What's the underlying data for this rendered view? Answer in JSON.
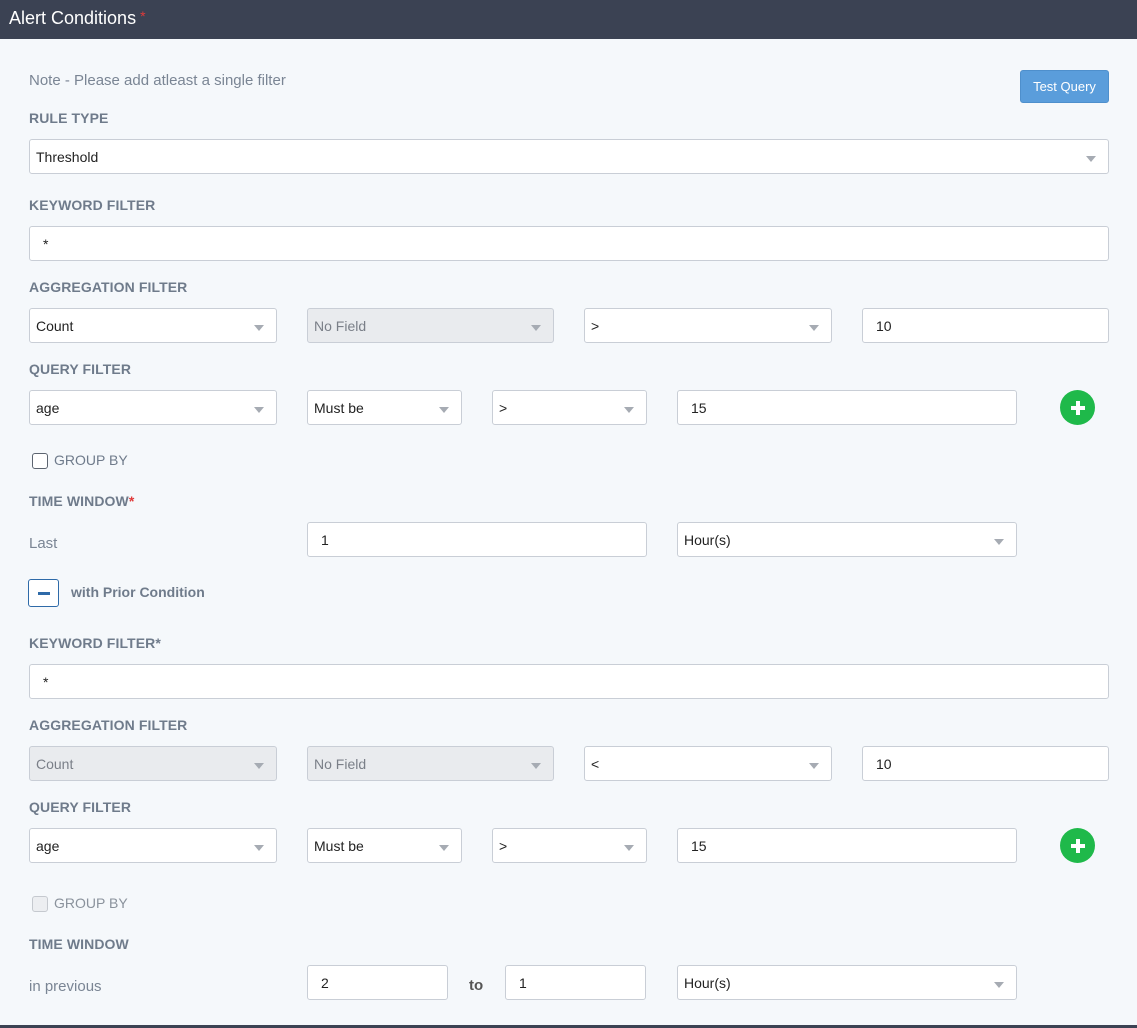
{
  "header": {
    "title": "Alert Conditions",
    "required_mark": "*"
  },
  "note": "Note - Please add atleast a single filter",
  "test_query_label": "Test Query",
  "rule_type": {
    "label": "RULE TYPE",
    "value": "Threshold"
  },
  "keyword_filter_1": {
    "label": "KEYWORD FILTER",
    "value": "*"
  },
  "aggregation_filter_1": {
    "label": "AGGREGATION FILTER",
    "function": "Count",
    "field": "No Field",
    "operator": ">",
    "value": "10"
  },
  "query_filter_1": {
    "label": "QUERY FILTER",
    "field": "age",
    "condition": "Must be",
    "operator": ">",
    "value": "15"
  },
  "group_by_1": {
    "label": "GROUP BY",
    "checked": false
  },
  "time_window_1": {
    "label": "TIME WINDOW",
    "required_mark": "*",
    "prefix": "Last",
    "value": "1",
    "unit": "Hour(s)"
  },
  "prior_condition_label": "with Prior Condition",
  "keyword_filter_2": {
    "label": "KEYWORD FILTER",
    "required_mark": "*",
    "value": "*"
  },
  "aggregation_filter_2": {
    "label": "AGGREGATION FILTER",
    "function": "Count",
    "field": "No Field",
    "operator": "<",
    "value": "10"
  },
  "query_filter_2": {
    "label": "QUERY FILTER",
    "field": "age",
    "condition": "Must be",
    "operator": ">",
    "value": "15"
  },
  "group_by_2": {
    "label": "GROUP BY",
    "checked": false
  },
  "time_window_2": {
    "label": "TIME WINDOW",
    "prefix": "in previous",
    "from_value": "2",
    "to_label": "to",
    "to_value": "1",
    "unit": "Hour(s)"
  },
  "colors": {
    "header_bg": "#3b4253",
    "accent_blue": "#5a9ddb",
    "add_green": "#1fb94a",
    "required_red": "#e03a3a"
  },
  "icons": {
    "add": "plus-icon",
    "collapse": "minus-icon",
    "dropdown": "chevron-down-icon"
  }
}
